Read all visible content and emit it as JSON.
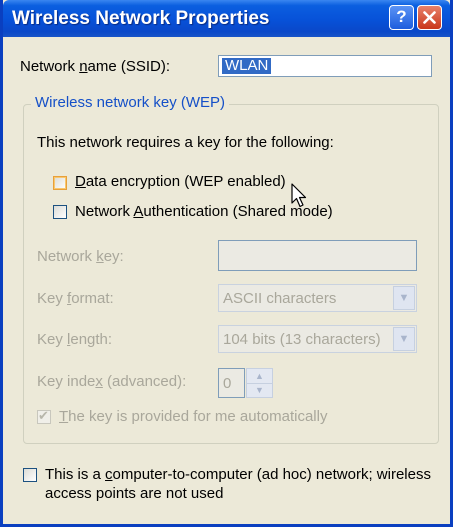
{
  "window": {
    "title": "Wireless Network Properties",
    "help_glyph": "?"
  },
  "ssid": {
    "label_pre": "Network ",
    "label_ul": "n",
    "label_post": "ame (SSID):",
    "value": "WLAN"
  },
  "wep_group": {
    "legend": "Wireless network key (WEP)",
    "intro": "This network requires a key for the following:",
    "data_encryption": {
      "ul": "D",
      "label": "ata encryption (WEP enabled)",
      "checked": false
    },
    "network_auth": {
      "pre": "Network ",
      "ul": "A",
      "post": "uthentication (Shared mode)",
      "checked": false
    },
    "network_key": {
      "pre": "Network ",
      "ul": "k",
      "post": "ey:",
      "value": ""
    },
    "key_format": {
      "pre": "Key ",
      "ul": "f",
      "post": "ormat:",
      "value": "ASCII characters"
    },
    "key_length": {
      "pre": "Key ",
      "ul": "l",
      "post": "ength:",
      "value": "104 bits (13 characters)"
    },
    "key_index": {
      "pre": "Key inde",
      "ul": "x",
      "post": " (advanced):",
      "value": "0"
    },
    "auto_key": {
      "pre": "",
      "ul": "T",
      "post": "he key is provided for me automatically",
      "checked": true
    }
  },
  "adhoc": {
    "pre": "This is a ",
    "ul": "c",
    "post": "omputer-to-computer (ad hoc) network; wireless",
    "line2": "access points are not used",
    "checked": false
  },
  "colors": {
    "title_bar": "#0751d8",
    "group_legend": "#1550c8",
    "disabled_text": "#a9a79b",
    "selection": "#316ac5"
  }
}
